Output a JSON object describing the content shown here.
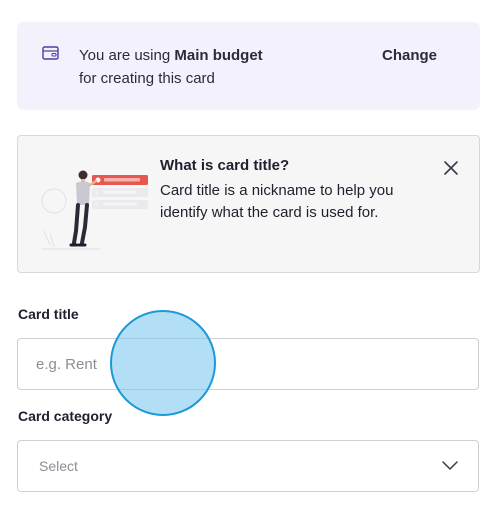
{
  "budget_banner": {
    "icon": "wallet-icon",
    "prefix": "You are using ",
    "budget_name": "Main budget",
    "suffix": "for creating this card",
    "change_label": "Change"
  },
  "info_card": {
    "illustration": "person-with-cards-illustration",
    "title": "What is card title?",
    "body": "Card title is a nickname to help you identify what the card is used for.",
    "close_icon": "close-icon"
  },
  "form": {
    "card_title": {
      "label": "Card title",
      "placeholder": "e.g. Rent",
      "value": ""
    },
    "card_category": {
      "label": "Card category",
      "selected": "Select",
      "icon": "chevron-down-icon"
    }
  },
  "colors": {
    "banner_bg": "#f3f1fb",
    "info_bg": "#f6f6f7",
    "accent_red": "#e8564f",
    "touch_fill": "#7ec8f0",
    "touch_border": "#1a9ad6"
  }
}
